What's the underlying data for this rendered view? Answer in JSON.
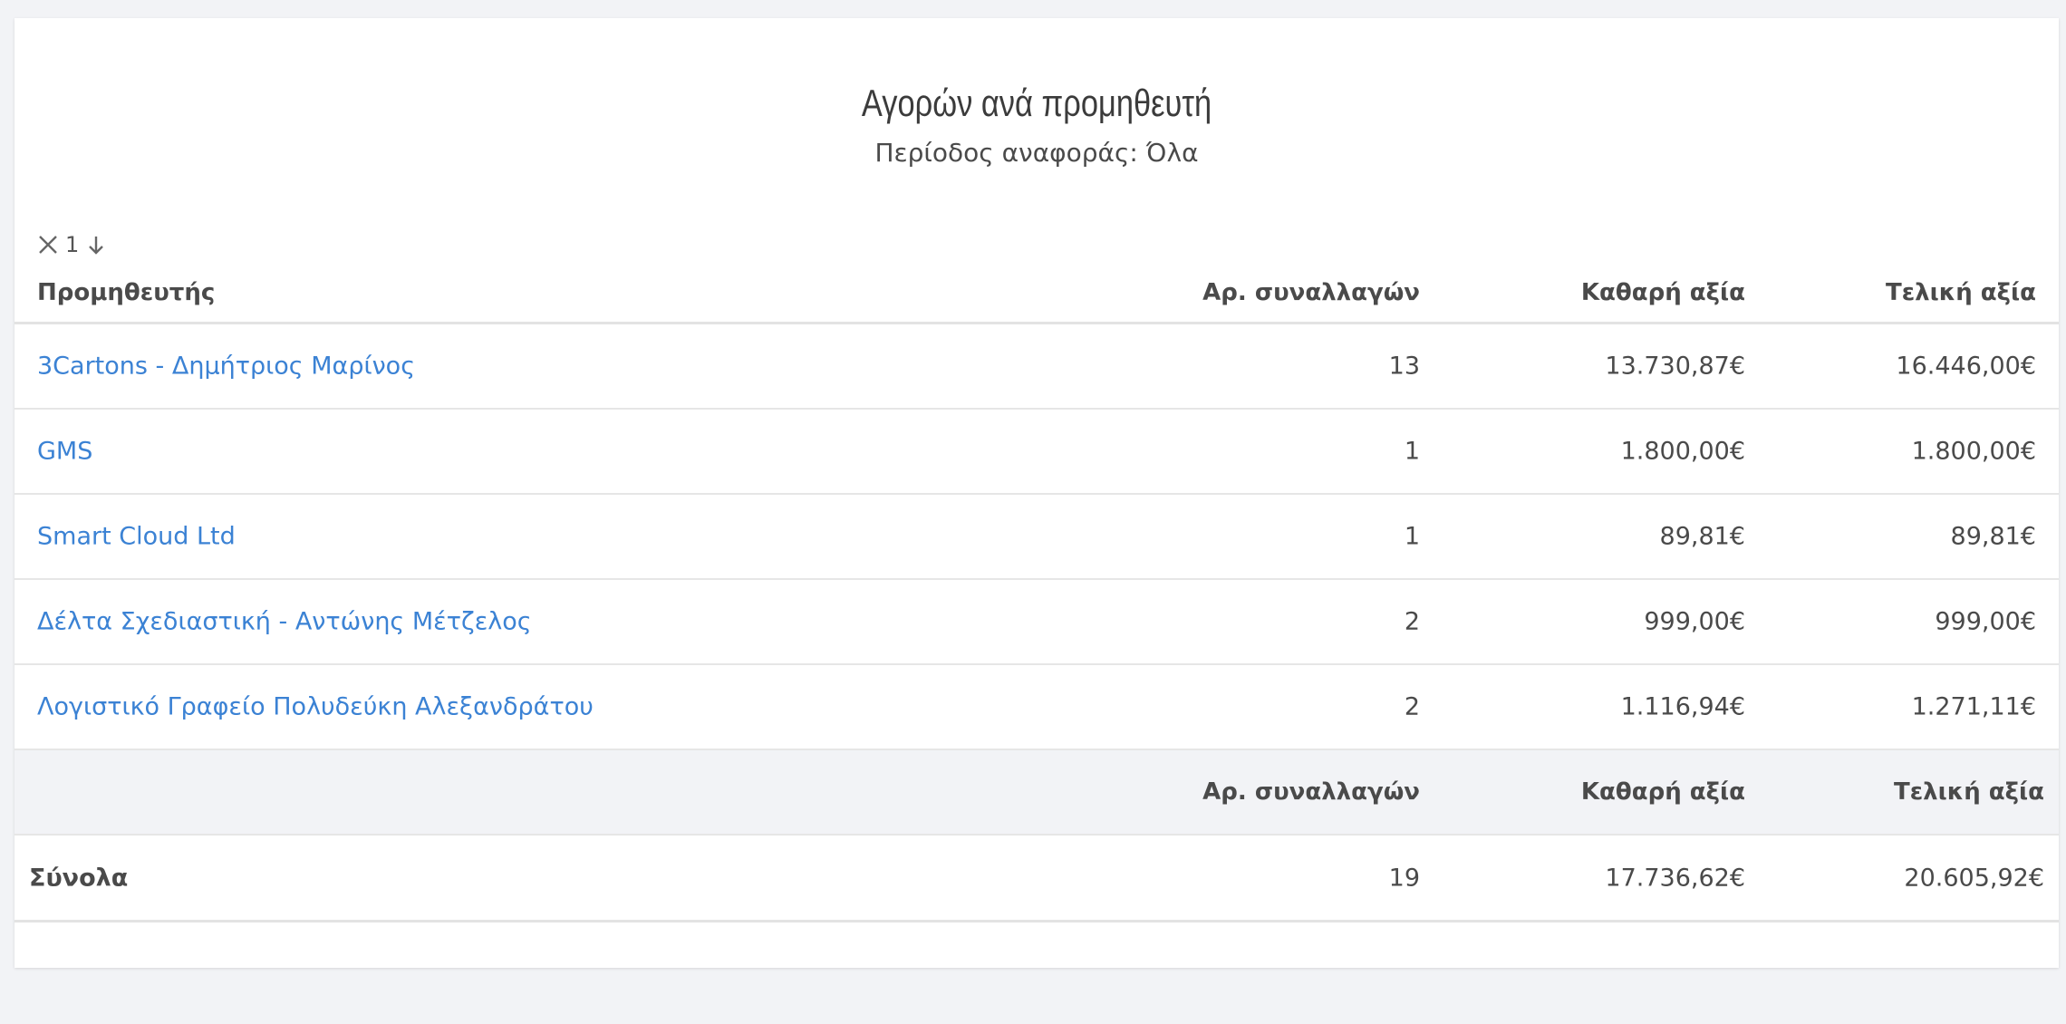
{
  "report": {
    "title": "Αγορών ανά προμηθευτή",
    "subtitle": "Περίοδος αναφοράς: Όλα"
  },
  "sort": {
    "level": "1"
  },
  "columns": {
    "supplier": "Προμηθευτής",
    "count": "Αρ. συναλλαγών",
    "net": "Καθαρή αξία",
    "final": "Τελική αξία"
  },
  "rows": [
    {
      "supplier": "3Cartons - Δημήτριος Μαρίνος",
      "count": "13",
      "net": "13.730,87€",
      "final": "16.446,00€"
    },
    {
      "supplier": "GMS",
      "count": "1",
      "net": "1.800,00€",
      "final": "1.800,00€"
    },
    {
      "supplier": "Smart Cloud Ltd",
      "count": "1",
      "net": "89,81€",
      "final": "89,81€"
    },
    {
      "supplier": "Δέλτα Σχεδιαστική - Αντώνης Μέτζελος",
      "count": "2",
      "net": "999,00€",
      "final": "999,00€"
    },
    {
      "supplier": "Λογιστικό Γραφείο Πολυδεύκη Αλεξανδράτου",
      "count": "2",
      "net": "1.116,94€",
      "final": "1.271,11€"
    }
  ],
  "footer": {
    "count_label": "Αρ. συναλλαγών",
    "net_label": "Καθαρή αξία",
    "final_label": "Τελική αξία",
    "totals_label": "Σύνολα",
    "total_count": "19",
    "total_net": "17.736,62€",
    "total_final": "20.605,92€"
  }
}
